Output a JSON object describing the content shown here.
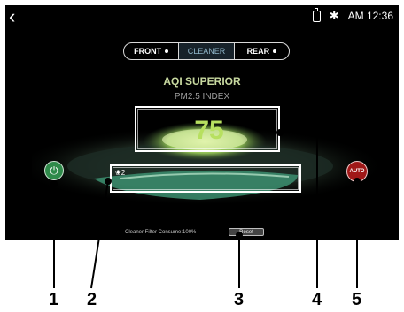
{
  "status": {
    "time": "AM 12:36",
    "icons": [
      "back-arrow-icon",
      "usb-icon",
      "bluetooth-icon"
    ]
  },
  "tabs": [
    {
      "label": "FRONT",
      "active": false
    },
    {
      "label": "CLEANER",
      "active": true
    },
    {
      "label": "REAR",
      "active": false
    }
  ],
  "aqi_title": "AQI SUPERIOR",
  "pm_label": "PM2.5 INDEX",
  "pm_value": "75",
  "fan_speed": "2",
  "power_icon": "power-icon",
  "auto_label": "AUTO",
  "filter_text": "Cleaner Filter Consume:100%",
  "reset_label": "Reset",
  "callouts": [
    "1",
    "2",
    "3",
    "4",
    "5"
  ],
  "colors": {
    "accent_green": "#b7e060",
    "power_green": "#2f8a4a",
    "auto_red": "#a01818"
  }
}
